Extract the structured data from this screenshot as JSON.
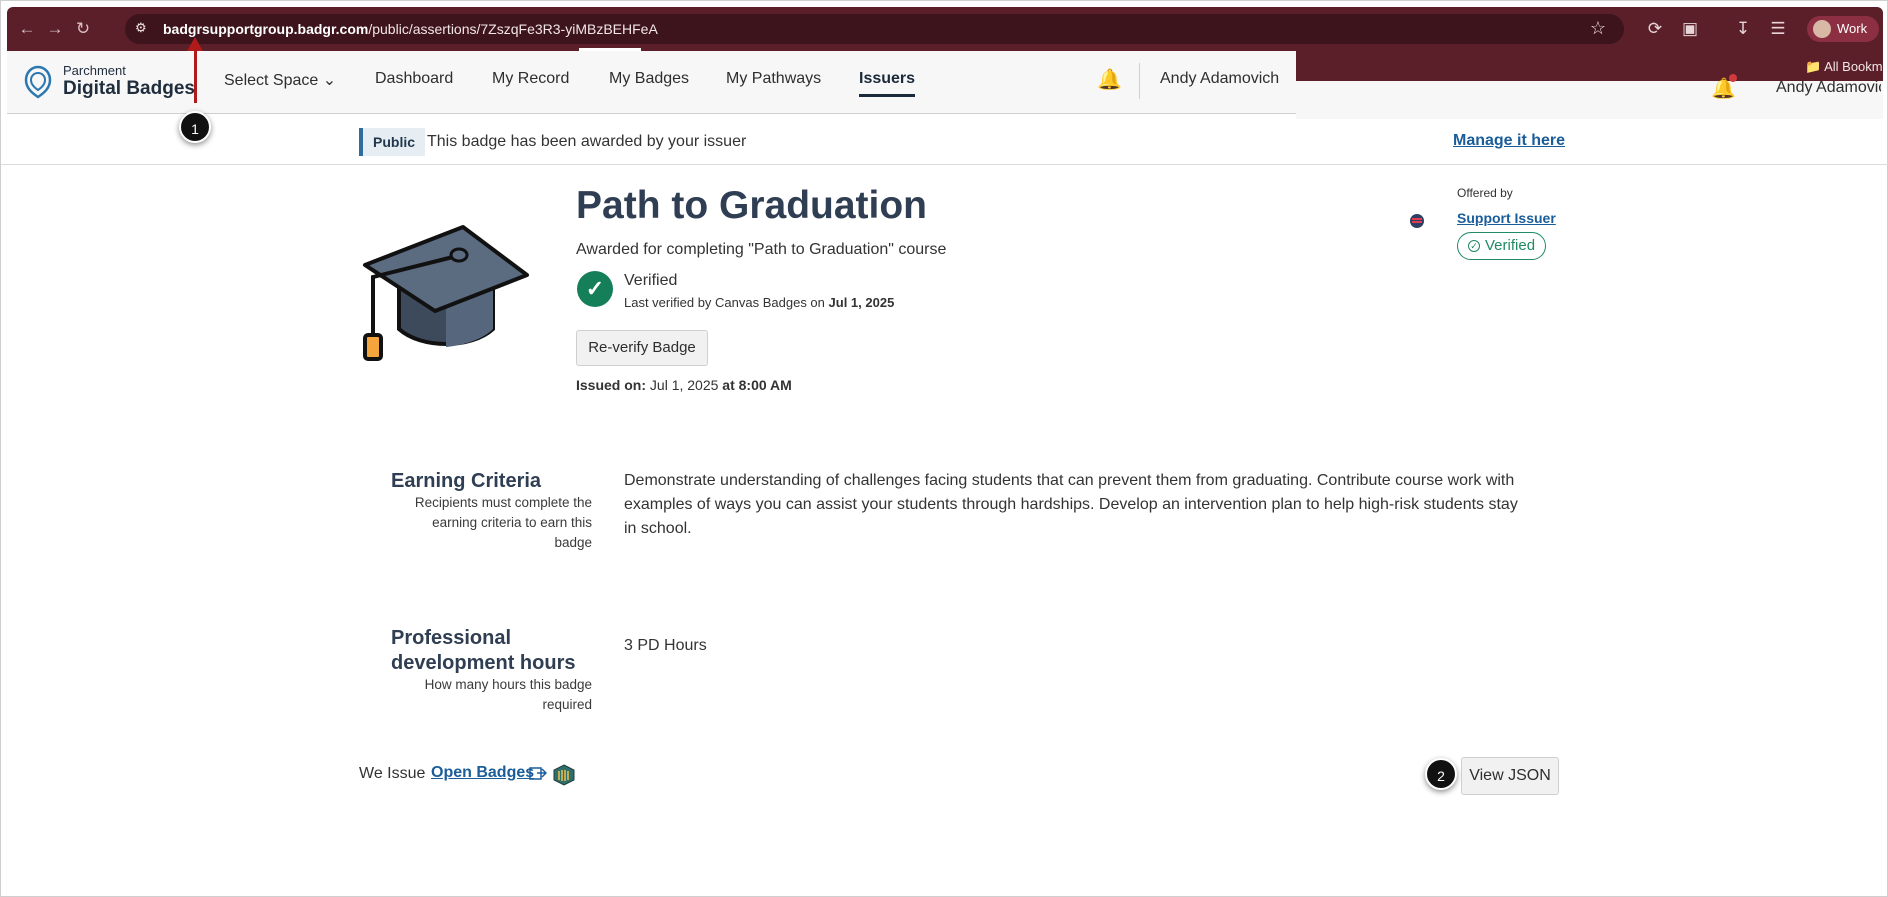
{
  "browser": {
    "url_domain": "badgrsupportgroup.badgr.com",
    "url_path": "/public/assertions/7ZszqFe3R3-yiMBzBEHFeA",
    "profile_label": "Work",
    "bookmarks_label": "All Bookm"
  },
  "header": {
    "logo_small": "Parchment",
    "logo_big": "Digital Badges",
    "menu": {
      "select_space": "Select Space",
      "dashboard": "Dashboard",
      "my_record": "My Record",
      "my_badges": "My Badges",
      "my_pathways": "My Pathways",
      "issuers": "Issuers"
    },
    "user_name": "Andy Adamovich",
    "user_name_truncated": "Andy Adamovic"
  },
  "notice": {
    "tag": "Public",
    "text": "This badge has been awarded by your issuer",
    "link": "Manage it here"
  },
  "badge": {
    "title": "Path to Graduation",
    "description": "Awarded for completing \"Path to Graduation\" course",
    "verified_title": "Verified",
    "verified_by_prefix": "Last verified by Canvas Badges on",
    "verified_date": "Jul 1, 2025",
    "reverify_label": "Re-verify Badge",
    "issued_label": "Issued on:",
    "issued_date": "Jul 1, 2025",
    "issued_at_label": "at",
    "issued_time": "8:00 AM"
  },
  "issuer": {
    "offered_by_label": "Offered by",
    "name": "Support Issuer",
    "verified_label": "Verified"
  },
  "criteria": {
    "title": "Earning Criteria",
    "help": "Recipients must complete the earning criteria to earn this badge",
    "body": "Demonstrate understanding of challenges facing students that can prevent them from graduating. Contribute course work with examples of ways you can assist your students through hardships. Develop an intervention plan to help high-risk students stay in school."
  },
  "pd_hours": {
    "title": "Professional development hours",
    "help": "How many hours this badge required",
    "body": "3 PD Hours"
  },
  "footer": {
    "we_issue": "We Issue",
    "open_badges": "Open Badges",
    "view_json": "View JSON"
  },
  "callouts": {
    "one": "1",
    "two": "2"
  },
  "colors": {
    "browser_frame": "#5a1f29",
    "link_blue": "#1a5d99",
    "verified_green": "#157f5a",
    "annotation_red": "#b01a1a"
  }
}
